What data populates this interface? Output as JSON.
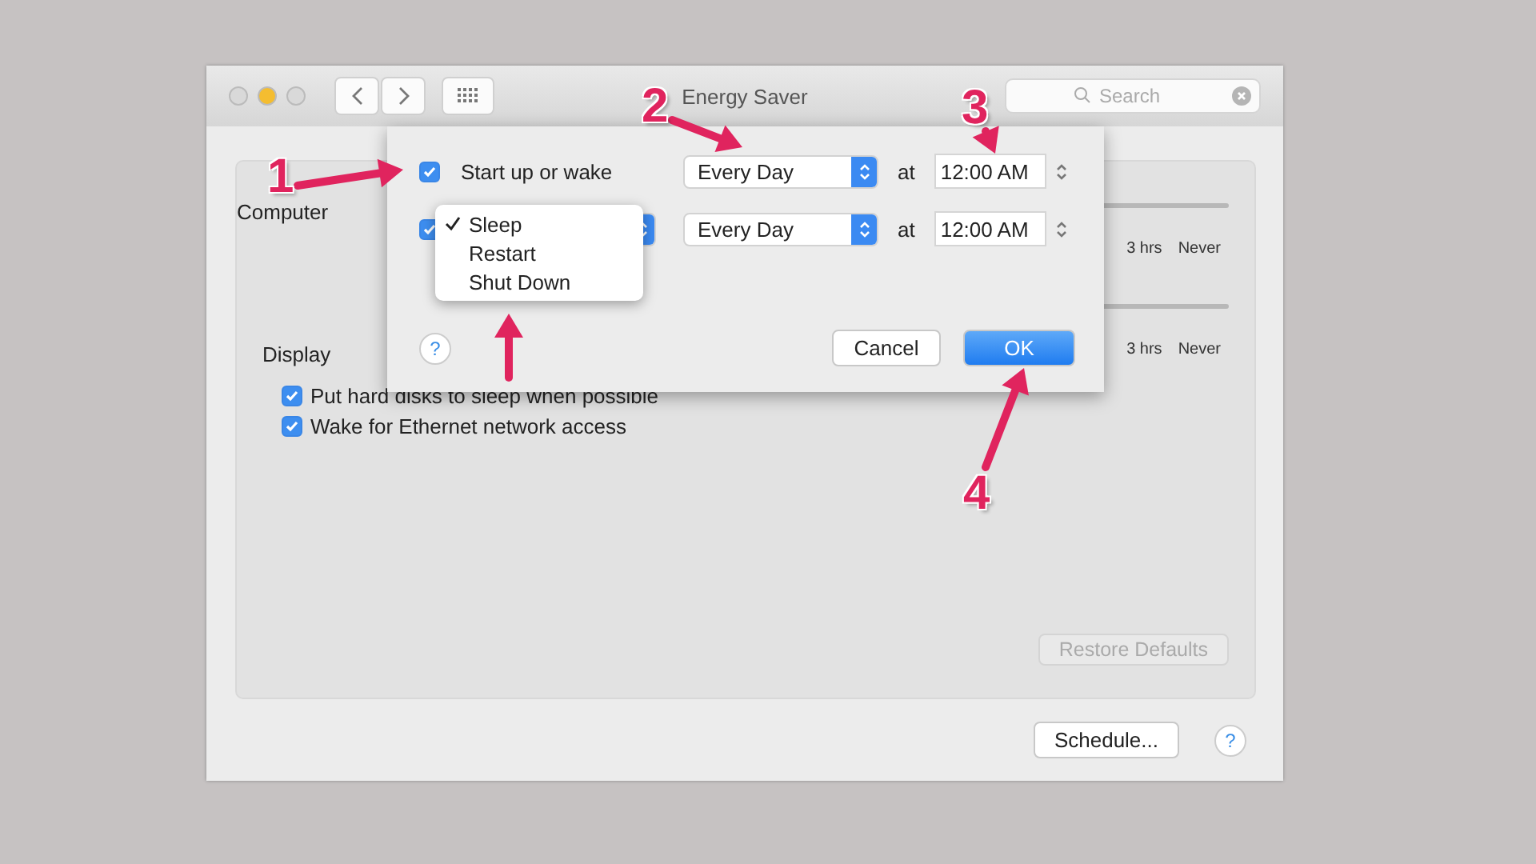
{
  "window": {
    "title": "Energy Saver",
    "search_placeholder": "Search"
  },
  "settings": {
    "rows": [
      {
        "label": "Computer",
        "ticks": [
          "3 hrs",
          "Never"
        ]
      },
      {
        "label": "Display",
        "ticks": [
          "3 hrs",
          "Never"
        ]
      }
    ],
    "checkboxes": [
      {
        "label": "Put hard disks to sleep when possible",
        "checked": true
      },
      {
        "label": "Wake for Ethernet network access",
        "checked": true
      }
    ],
    "restore_button": {
      "label": "Restore Defaults",
      "disabled": true
    }
  },
  "footer": {
    "schedule_button": "Schedule...",
    "help": "?"
  },
  "schedule_sheet": {
    "rows": [
      {
        "kind": "label",
        "checked": true,
        "label": "Start up or wake",
        "frequency": "Every Day",
        "at": "at",
        "time": "12:00 AM"
      },
      {
        "kind": "action",
        "checked": true,
        "frequency": "Every Day",
        "at": "at",
        "time": "12:00 AM"
      }
    ],
    "menu": [
      {
        "label": "Sleep",
        "selected": true
      },
      {
        "label": "Restart",
        "selected": false
      },
      {
        "label": "Shut Down",
        "selected": false
      }
    ],
    "help": "?",
    "cancel_button": "Cancel",
    "ok_button": "OK"
  },
  "annotations": [
    {
      "kind": "numbered",
      "number": "1"
    },
    {
      "kind": "numbered",
      "number": "2"
    },
    {
      "kind": "numbered",
      "number": "3"
    },
    {
      "kind": "numbered",
      "number": "4"
    },
    {
      "kind": "arrow"
    }
  ]
}
